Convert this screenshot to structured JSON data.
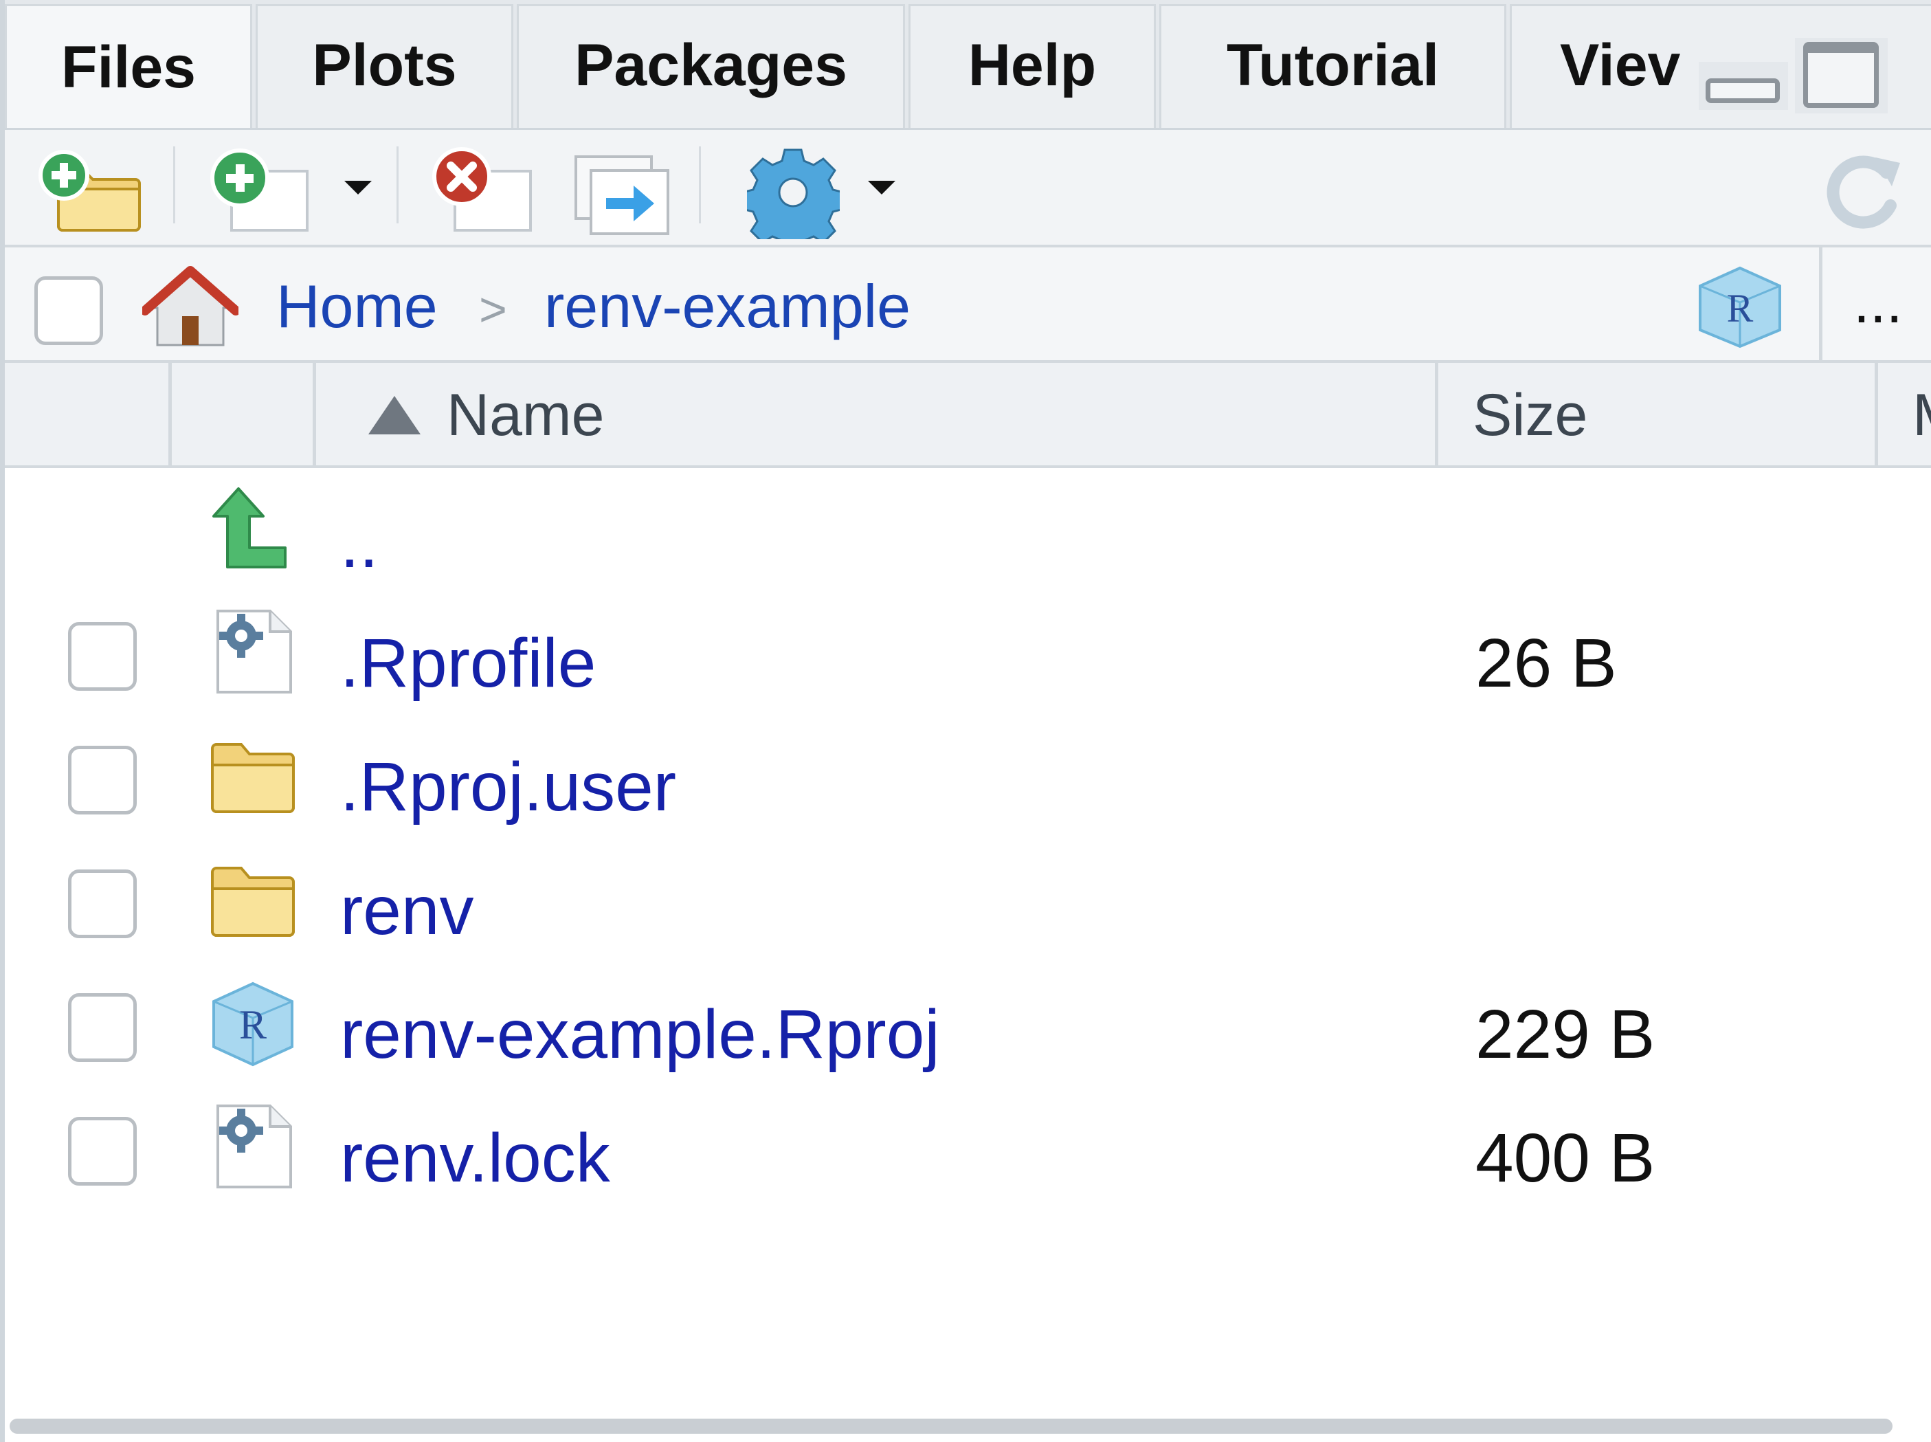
{
  "tabs": [
    {
      "label": "Files",
      "active": true
    },
    {
      "label": "Plots",
      "active": false
    },
    {
      "label": "Packages",
      "active": false
    },
    {
      "label": "Help",
      "active": false
    },
    {
      "label": "Tutorial",
      "active": false
    },
    {
      "label": "Viev",
      "active": false
    }
  ],
  "toolbar": {
    "new_folder": "new-folder-icon",
    "new_file": "new-blank-file-icon",
    "delete": "delete-file-icon",
    "rename": "rename-file-icon",
    "more": "gear-icon",
    "refresh": "refresh-icon"
  },
  "breadcrumb": {
    "home": "Home",
    "separator": ">",
    "current": "renv-example",
    "overflow": "..."
  },
  "columns": {
    "name": "Name",
    "size": "Size",
    "modified": "M",
    "sort_direction": "ascending"
  },
  "files": [
    {
      "name": "..",
      "size": "",
      "type": "parent",
      "checkbox": false
    },
    {
      "name": ".Rprofile",
      "size": "26 B",
      "type": "config",
      "checkbox": true
    },
    {
      "name": ".Rproj.user",
      "size": "",
      "type": "folder",
      "checkbox": true
    },
    {
      "name": "renv",
      "size": "",
      "type": "folder",
      "checkbox": true
    },
    {
      "name": "renv-example.Rproj",
      "size": "229 B",
      "type": "rproj",
      "checkbox": true
    },
    {
      "name": "renv.lock",
      "size": "400 B",
      "type": "config",
      "checkbox": true
    }
  ],
  "colors": {
    "link": "#1521a8",
    "breadcrumb_link": "#1a44b4",
    "accent_green": "#3aa35a",
    "delete_red": "#c0392b"
  }
}
